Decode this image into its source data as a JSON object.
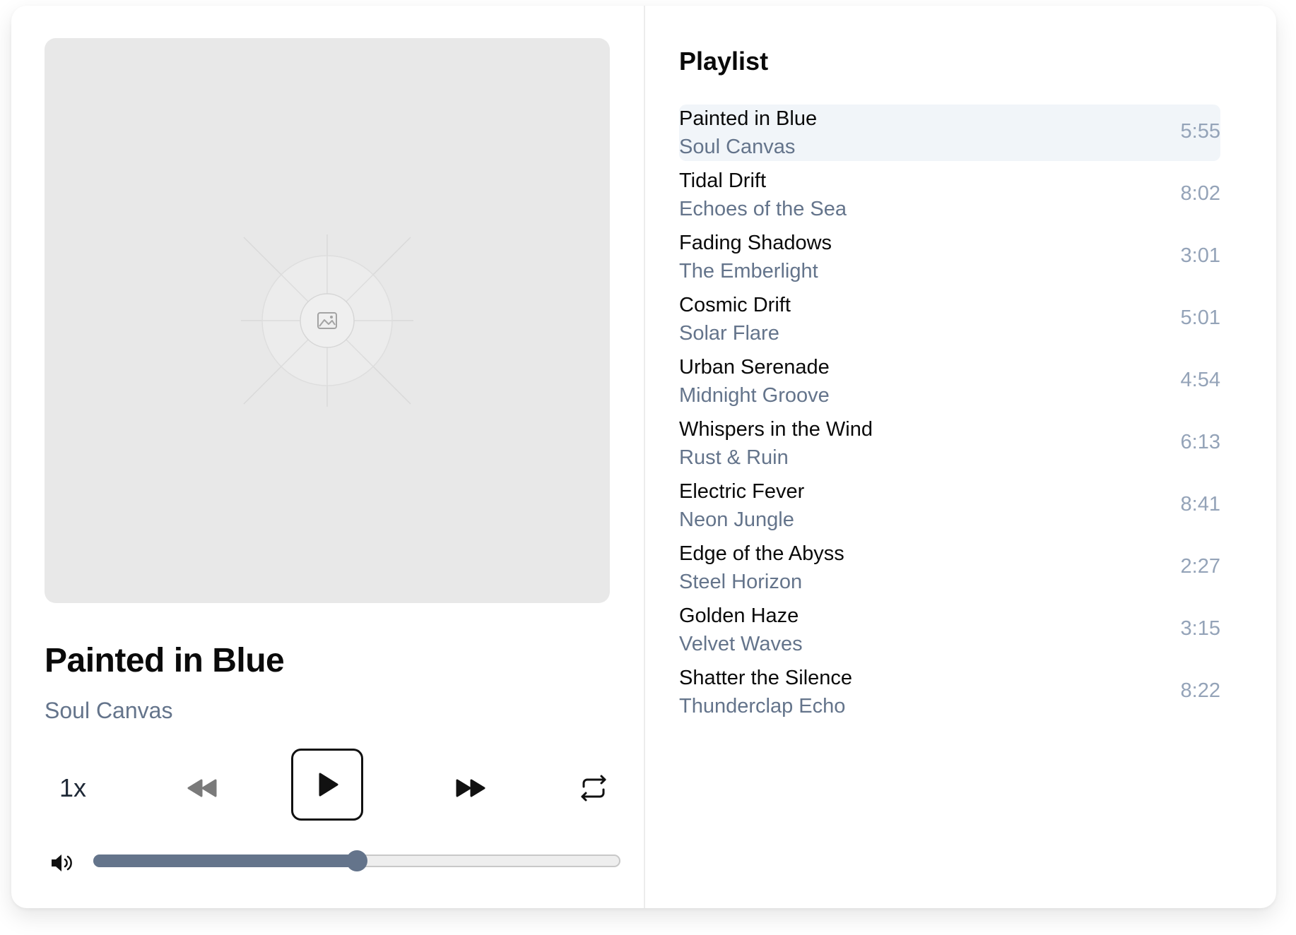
{
  "player": {
    "artwork_icon": "image-placeholder-icon",
    "title": "Painted in Blue",
    "artist": "Soul Canvas",
    "speed_label": "1x",
    "volume_level": 0.5,
    "accent_color": "#64748b"
  },
  "controls": {
    "speed": "1x",
    "rewind_icon": "rewind-icon",
    "play_icon": "play-icon",
    "forward_icon": "fast-forward-icon",
    "repeat_icon": "repeat-icon",
    "volume_icon": "speaker-icon"
  },
  "playlist": {
    "heading": "Playlist",
    "items": [
      {
        "title": "Painted in Blue",
        "artist": "Soul Canvas",
        "duration": "5:55",
        "active": true
      },
      {
        "title": "Tidal Drift",
        "artist": "Echoes of the Sea",
        "duration": "8:02"
      },
      {
        "title": "Fading Shadows",
        "artist": "The Emberlight",
        "duration": "3:01"
      },
      {
        "title": "Cosmic Drift",
        "artist": "Solar Flare",
        "duration": "5:01"
      },
      {
        "title": "Urban Serenade",
        "artist": "Midnight Groove",
        "duration": "4:54"
      },
      {
        "title": "Whispers in the Wind",
        "artist": "Rust & Ruin",
        "duration": "6:13"
      },
      {
        "title": "Electric Fever",
        "artist": "Neon Jungle",
        "duration": "8:41"
      },
      {
        "title": "Edge of the Abyss",
        "artist": "Steel Horizon",
        "duration": "2:27"
      },
      {
        "title": "Golden Haze",
        "artist": "Velvet Waves",
        "duration": "3:15"
      },
      {
        "title": "Shatter the Silence",
        "artist": "Thunderclap Echo",
        "duration": "8:22"
      }
    ]
  }
}
